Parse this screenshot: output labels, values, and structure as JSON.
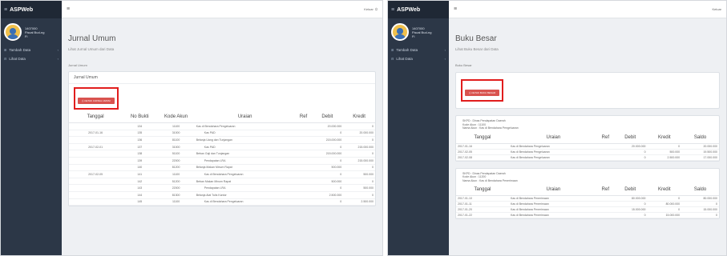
{
  "left": {
    "brand": "ASPWeb",
    "user": {
      "line1": "1407000",
      "line2": "Fiscal Bud-ng",
      "line3": "Fi"
    },
    "menu": [
      "Tambah Data",
      "Lihat Data"
    ],
    "topbar_user": "Keluar",
    "page_title": "Jurnal Umum",
    "page_subtitle": "Lihat Jurnal Umum dari Data",
    "breadcrumb": "Jurnal Umum",
    "card_title": "Jurnal Umum",
    "print_button": "CETAK JURNAL UMUM",
    "columns": [
      "Tanggal",
      "No Bukti",
      "Kode Akun",
      "Uraian",
      "Ref",
      "Debit",
      "Kredit"
    ],
    "rows": [
      {
        "tanggal": "",
        "bukti": "134",
        "kode": "11100",
        "uraian": "Kas di Bendahara Pengeluaran",
        "indent": false,
        "ref": "",
        "debit": "20.000.000",
        "kredit": "0"
      },
      {
        "tanggal": "2017-01-16",
        "bukti": "135",
        "kode": "31000",
        "uraian": "Kas PAD",
        "indent": true,
        "ref": "",
        "debit": "0",
        "kredit": "20.000.000"
      },
      {
        "tanggal": "",
        "bukti": "136",
        "kode": "81100",
        "uraian": "Belanja Uang dan Tunjangan",
        "indent": false,
        "ref": "",
        "debit": "215.000.000",
        "kredit": "0"
      },
      {
        "tanggal": "2017-02-01",
        "bukti": "137",
        "kode": "31000",
        "uraian": "Kas PAD",
        "indent": true,
        "ref": "",
        "debit": "0",
        "kredit": "215.000.000"
      },
      {
        "tanggal": "",
        "bukti": "138",
        "kode": "51100",
        "uraian": "Beban Gaji dan Tunjangan",
        "indent": false,
        "ref": "",
        "debit": "215.000.000",
        "kredit": "0"
      },
      {
        "tanggal": "",
        "bukti": "139",
        "kode": "22000",
        "uraian": "Pendapatan LRA",
        "indent": true,
        "ref": "",
        "debit": "0",
        "kredit": "215.000.000"
      },
      {
        "tanggal": "",
        "bukti": "140",
        "kode": "81200",
        "uraian": "Belanja Makan Minum Rapat",
        "indent": false,
        "ref": "",
        "debit": "500.000",
        "kredit": "0"
      },
      {
        "tanggal": "2017-02-05",
        "bukti": "141",
        "kode": "11100",
        "uraian": "Kas di Bendahara Pengeluaran",
        "indent": true,
        "ref": "",
        "debit": "0",
        "kredit": "500.000"
      },
      {
        "tanggal": "",
        "bukti": "142",
        "kode": "51200",
        "uraian": "Beban Makan Minum Rapat",
        "indent": false,
        "ref": "",
        "debit": "500.000",
        "kredit": "0"
      },
      {
        "tanggal": "",
        "bukti": "143",
        "kode": "22000",
        "uraian": "Pendapatan LRA",
        "indent": true,
        "ref": "",
        "debit": "0",
        "kredit": "500.000"
      },
      {
        "tanggal": "",
        "bukti": "144",
        "kode": "81300",
        "uraian": "Belanja Alat Tulis Kantor",
        "indent": false,
        "ref": "",
        "debit": "2.500.000",
        "kredit": "0"
      },
      {
        "tanggal": "",
        "bukti": "145",
        "kode": "11100",
        "uraian": "Kas di Bendahara Pengeluaran",
        "indent": true,
        "ref": "",
        "debit": "0",
        "kredit": "2.500.000"
      }
    ]
  },
  "right": {
    "brand": "ASPWeb",
    "user": {
      "line1": "1407000",
      "line2": "Fiscal Bud-ng",
      "line3": "Fi"
    },
    "menu": [
      "Tambah Data",
      "Lihat Data"
    ],
    "topbar_user": "Keluar",
    "page_title": "Buku Besar",
    "page_subtitle": "Lihat Buku Besar dari Data",
    "breadcrumb": "Buku Besar",
    "print_button": "CETAK BUKU BESAR",
    "columns": [
      "Tanggal",
      "Uraian",
      "Ref",
      "Debit",
      "Kredit",
      "Saldo"
    ],
    "ledgers": [
      {
        "meta": [
          "SKPD : Dinas Pendapatan Daerah",
          "Kode Akun : 11100",
          "Nama Akun : Kas di Bendahara Pengeluaran"
        ],
        "rows": [
          {
            "tanggal": "2017-01-16",
            "uraian": "Kas di Bendahara Pengeluaran",
            "ref": "",
            "debit": "20.000.000",
            "kredit": "0",
            "saldo": "20.000.000"
          },
          {
            "tanggal": "2017-02-05",
            "uraian": "Kas di Bendahara Pengeluaran",
            "ref": "",
            "debit": "0",
            "kredit": "500.000",
            "saldo": "19.500.000"
          },
          {
            "tanggal": "2017-02-08",
            "uraian": "Kas di Bendahara Pengeluaran",
            "ref": "",
            "debit": "0",
            "kredit": "2.500.000",
            "saldo": "17.000.000"
          }
        ]
      },
      {
        "meta": [
          "SKPD : Dinas Pendapatan Daerah",
          "Kode Akun : 11200",
          "Nama Akun : Kas di Bendahara Penerimaan"
        ],
        "rows": [
          {
            "tanggal": "2017-01-10",
            "uraian": "Kas di Bendahara Penerimaan",
            "ref": "",
            "debit": "80.000.000",
            "kredit": "0",
            "saldo": "80.000.000"
          },
          {
            "tanggal": "2017-01-11",
            "uraian": "Kas di Bendahara Penerimaan",
            "ref": "",
            "debit": "0",
            "kredit": "80.000.000",
            "saldo": "0"
          },
          {
            "tanggal": "2017-01-20",
            "uraian": "Kas di Bendahara Penerimaan",
            "ref": "",
            "debit": "15.000.000",
            "kredit": "0",
            "saldo": "15.000.000"
          },
          {
            "tanggal": "2017-01-22",
            "uraian": "Kas di Bendahara Penerimaan",
            "ref": "",
            "debit": "0",
            "kredit": "15.000.000",
            "saldo": "0"
          }
        ]
      }
    ]
  }
}
